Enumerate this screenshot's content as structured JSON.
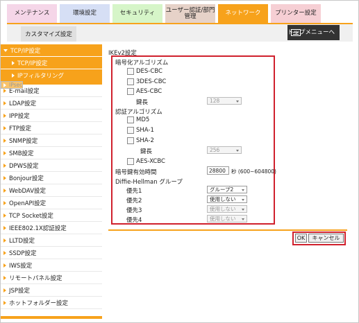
{
  "tabs": [
    {
      "label": "メンテナンス"
    },
    {
      "label": "環境設定"
    },
    {
      "label": "セキュリティ"
    },
    {
      "label": "ユーザー認証/部門管理"
    },
    {
      "label": "ネットワーク"
    },
    {
      "label": "プリンター設定"
    }
  ],
  "subtab": "カスタマイズ設定",
  "top_menu": "トップメニューへ",
  "sidebar": {
    "header": "TCP/IP設定",
    "subs": [
      "TCP/IP設定",
      "IPフィルタリング",
      "IPsec"
    ],
    "items": [
      "E-mail設定",
      "LDAP設定",
      "IPP設定",
      "FTP設定",
      "SNMP設定",
      "SMB設定",
      "DPWS設定",
      "Bonjour設定",
      "WebDAV設定",
      "OpenAPI設定",
      "TCP Socket設定",
      "IEEE802.1X認証設定",
      "LLTD設定",
      "SSDP設定",
      "IWS設定",
      "リモートパネル設定",
      "JSP設定",
      "ホットフォルダー設定"
    ]
  },
  "main": {
    "title": "IKEv2設定",
    "enc_algo": "暗号化アルゴリズム",
    "des": "DES-CBC",
    "des3": "3DES-CBC",
    "aes": "AES-CBC",
    "keylen": "鍵長",
    "keylen_val": "128",
    "auth_algo": "認証アルゴリズム",
    "md5": "MD5",
    "sha1": "SHA-1",
    "sha2": "SHA-2",
    "keylen2": "鍵長",
    "keylen2_val": "256",
    "aesx": "AES-XCBC",
    "lifetime_label": "暗号鍵有効時間",
    "lifetime_val": "28800",
    "lifetime_unit": "秒 (600~604800)",
    "dh": "Diffie-Hellman グループ",
    "p1": "優先1",
    "p1_val": "グループ2",
    "p2": "優先2",
    "p2_val": "使用しない",
    "p3": "優先3",
    "p3_val": "使用しない",
    "p4": "優先4",
    "p4_val": "使用しない"
  },
  "buttons": {
    "ok": "OK",
    "cancel": "キャンセル"
  },
  "colors": {
    "accent": "#f7a21b",
    "highlight": "#d0202c"
  }
}
